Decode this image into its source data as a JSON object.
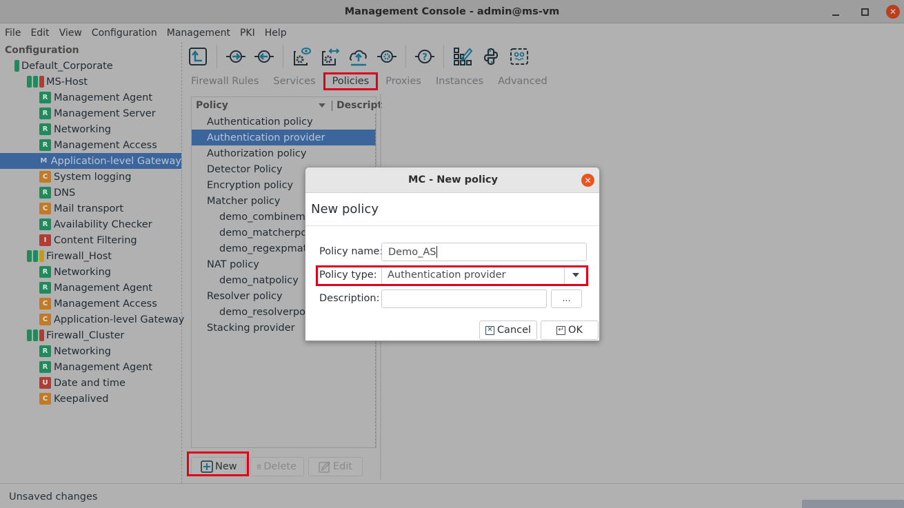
{
  "window": {
    "title": "Management Console - admin@ms-vm",
    "controls": {
      "minimize": "minimize-icon",
      "maximize": "maximize-icon",
      "close": "close-icon"
    }
  },
  "menubar": {
    "items": [
      "File",
      "Edit",
      "View",
      "Configuration",
      "Management",
      "PKI",
      "Help"
    ]
  },
  "tree": {
    "header": "Configuration",
    "nodes": [
      {
        "label": "Default_Corporate",
        "level": 0,
        "status": [
          "#1f8a5c"
        ]
      },
      {
        "label": "MS-Host",
        "level": 1,
        "status": [
          "#1f8a5c",
          "#1f8a5c",
          "#b23b33"
        ]
      },
      {
        "label": "Management Agent",
        "level": 2,
        "badge": "R"
      },
      {
        "label": "Management Server",
        "level": 2,
        "badge": "R"
      },
      {
        "label": "Networking",
        "level": 2,
        "badge": "R"
      },
      {
        "label": "Management Access",
        "level": 2,
        "badge": "R"
      },
      {
        "label": "Application-level Gateway",
        "level": 2,
        "badge": "M",
        "selected": true
      },
      {
        "label": "System logging",
        "level": 2,
        "badge": "C"
      },
      {
        "label": "DNS",
        "level": 2,
        "badge": "R"
      },
      {
        "label": "Mail transport",
        "level": 2,
        "badge": "C"
      },
      {
        "label": "Availability Checker",
        "level": 2,
        "badge": "R"
      },
      {
        "label": "Content Filtering",
        "level": 2,
        "badge": "I"
      },
      {
        "label": "Firewall_Host",
        "level": 1,
        "status": [
          "#1f8a5c",
          "#1f8a5c",
          "#c89a10"
        ]
      },
      {
        "label": "Networking",
        "level": 2,
        "badge": "R"
      },
      {
        "label": "Management Agent",
        "level": 2,
        "badge": "R"
      },
      {
        "label": "Management Access",
        "level": 2,
        "badge": "C"
      },
      {
        "label": "Application-level Gateway",
        "level": 2,
        "badge": "C"
      },
      {
        "label": "Firewall_Cluster",
        "level": 1,
        "status": [
          "#1f8a5c",
          "#1f8a5c",
          "#b23b33"
        ]
      },
      {
        "label": "Networking",
        "level": 2,
        "badge": "R"
      },
      {
        "label": "Management Agent",
        "level": 2,
        "badge": "R"
      },
      {
        "label": "Date and time",
        "level": 2,
        "badge": "U"
      },
      {
        "label": "Keepalived",
        "level": 2,
        "badge": "C"
      }
    ]
  },
  "toolbar": {
    "buttons": [
      "upload-config-icon",
      "connect-in-icon",
      "connect-out-icon",
      "view-config-icon",
      "compare-config-icon",
      "upload-cloud-icon",
      "service-gear-icon",
      "help-query-icon",
      "edit-grid-icon",
      "python-icon",
      "robot-icon"
    ]
  },
  "tabs": [
    {
      "label": "Firewall Rules",
      "active": false
    },
    {
      "label": "Services",
      "active": false
    },
    {
      "label": "Policies",
      "active": true
    },
    {
      "label": "Proxies",
      "active": false
    },
    {
      "label": "Instances",
      "active": false
    },
    {
      "label": "Advanced",
      "active": false
    }
  ],
  "policy_list": {
    "columns": [
      "Policy",
      "Descript"
    ],
    "rows": [
      {
        "label": "Authentication policy",
        "level": 0
      },
      {
        "label": "Authentication provider",
        "level": 0,
        "selected": true
      },
      {
        "label": "Authorization policy",
        "level": 0
      },
      {
        "label": "Detector Policy",
        "level": 0
      },
      {
        "label": "Encryption policy",
        "level": 0
      },
      {
        "label": "Matcher policy",
        "level": 0
      },
      {
        "label": "demo_combinematcher",
        "level": 1
      },
      {
        "label": "demo_matcherpolicy",
        "level": 1
      },
      {
        "label": "demo_regexpmatcher",
        "level": 1
      },
      {
        "label": "NAT policy",
        "level": 0
      },
      {
        "label": "demo_natpolicy",
        "level": 1
      },
      {
        "label": "Resolver policy",
        "level": 0
      },
      {
        "label": "demo_resolverpolicy",
        "level": 1
      },
      {
        "label": "Stacking provider",
        "level": 0
      }
    ],
    "buttons": {
      "new": "New",
      "delete": "Delete",
      "edit": "Edit"
    }
  },
  "dialog": {
    "title": "MC - New policy",
    "heading": "New policy",
    "fields": {
      "name_label": "Policy name:",
      "name_value": "Demo_AS",
      "type_label": "Policy type:",
      "type_value": "Authentication provider",
      "desc_label": "Description:",
      "desc_value": "",
      "desc_button": "..."
    },
    "buttons": {
      "cancel": "Cancel",
      "ok": "OK"
    }
  },
  "statusbar": {
    "text": "Unsaved changes"
  }
}
